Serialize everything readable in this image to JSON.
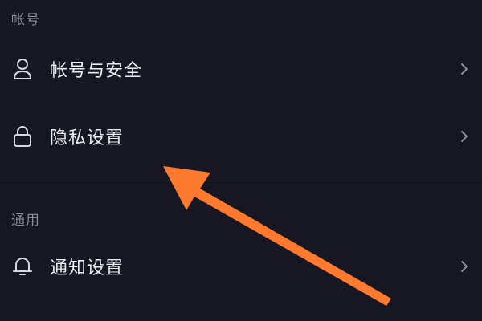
{
  "sections": [
    {
      "header": "帐号",
      "items": [
        {
          "label": "帐号与安全",
          "icon": "user-icon"
        },
        {
          "label": "隐私设置",
          "icon": "lock-icon"
        }
      ]
    },
    {
      "header": "通用",
      "items": [
        {
          "label": "通知设置",
          "icon": "bell-icon"
        }
      ]
    }
  ],
  "colors": {
    "background": "#161722",
    "text": "#ececf1",
    "section_header": "#8b8c98",
    "arrow": "#ff7a2f"
  },
  "annotation": {
    "type": "arrow",
    "icon": "arrow-pointer-icon"
  }
}
